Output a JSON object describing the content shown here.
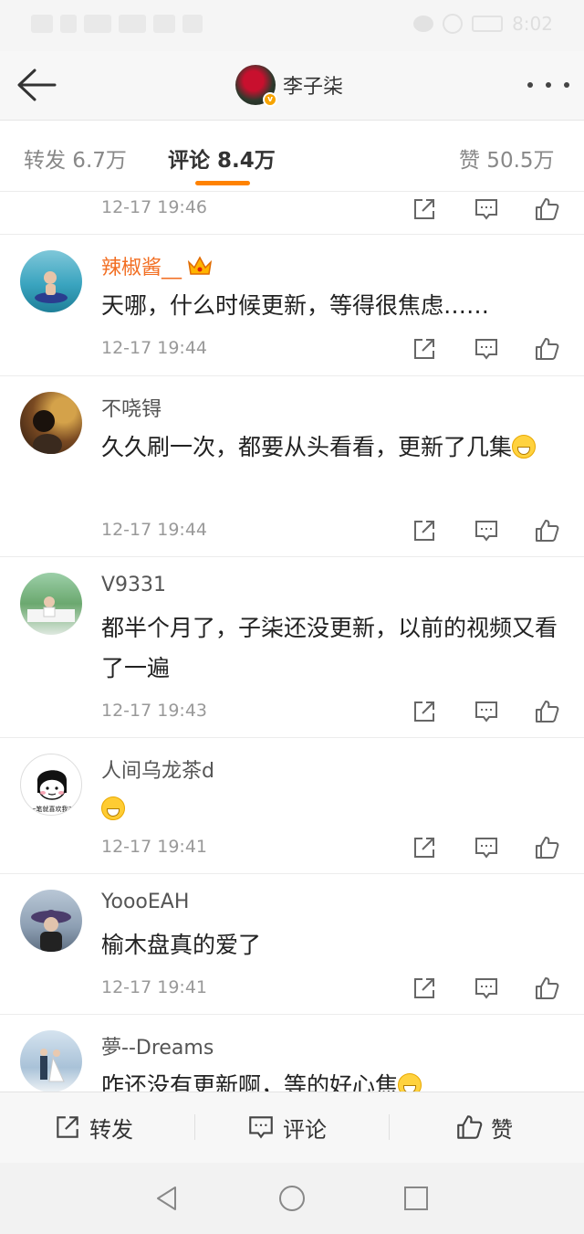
{
  "status_bar": {
    "time": "8:02"
  },
  "header": {
    "title": "李子柒",
    "back_icon": "arrow-left-icon",
    "more_icon": "more-dots-icon"
  },
  "tabs": [
    {
      "label": "转发 6.7万"
    },
    {
      "label": "评论 8.4万",
      "active": true
    },
    {
      "label": "赞 50.5万"
    }
  ],
  "comments": [
    {
      "name": "",
      "text": "",
      "time": "12-17 19:46"
    },
    {
      "name": "辣椒酱__",
      "vip": true,
      "text": "天哪，什么时候更新，等得很焦虑……",
      "time": "12-17 19:44"
    },
    {
      "name": "不哓锝",
      "text": "久久刷一次，都要从头看看，更新了几集",
      "time": "12-17 19:44"
    },
    {
      "name": "V9331",
      "text": "都半个月了，子柒还没更新，以前的视频又看了一遍",
      "time": "12-17 19:43"
    },
    {
      "name": "人间乌龙茶d",
      "text": "",
      "time": "12-17 19:41"
    },
    {
      "name": "YoooEAH",
      "text": "榆木盘真的爱了",
      "time": "12-17 19:41"
    },
    {
      "name": "夢--Dreams",
      "text": "咋还没有更新啊，等的好心焦",
      "time": ""
    }
  ],
  "avatar_label": "一笔就喜欢我对",
  "bottom_bar": {
    "repost": "转发",
    "comment": "评论",
    "like": "赞"
  },
  "colors": {
    "accent": "#ff8200",
    "vip_name": "#f26e22"
  }
}
